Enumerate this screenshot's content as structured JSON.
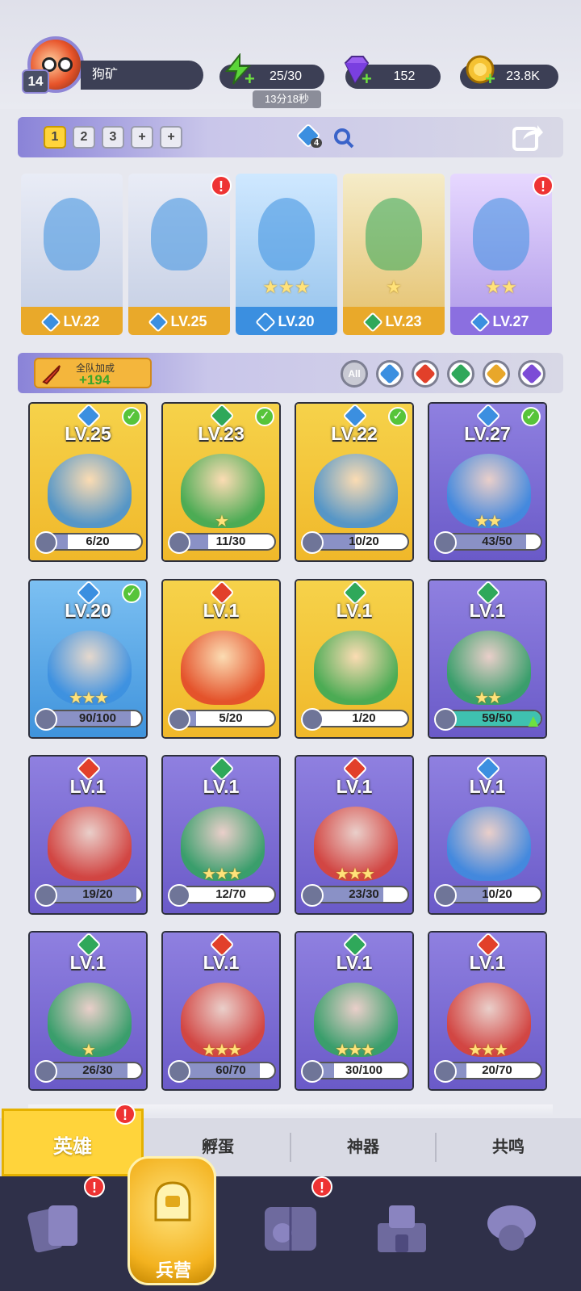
{
  "header": {
    "level": "14",
    "name": "狗矿",
    "energy": "25/30",
    "timer": "13分18秒",
    "gems": "152",
    "gold": "23.8K"
  },
  "team": {
    "slots": [
      "1",
      "2",
      "3",
      "+",
      "+"
    ],
    "count": "4"
  },
  "lineup": [
    {
      "lv": "LV.22",
      "elem": "water",
      "stars": ""
    },
    {
      "lv": "LV.25",
      "elem": "water",
      "stars": "",
      "alert": "!"
    },
    {
      "lv": "LV.20",
      "elem": "water",
      "stars": "★★★"
    },
    {
      "lv": "LV.23",
      "elem": "wind",
      "stars": "★"
    },
    {
      "lv": "LV.27",
      "elem": "water",
      "stars": "★★",
      "alert": "!"
    }
  ],
  "bonus": {
    "label": "全队加成",
    "value": "+194"
  },
  "filters": {
    "all": "All",
    "items": [
      "water",
      "fire",
      "wind",
      "light",
      "dark"
    ]
  },
  "heroes": [
    {
      "lv": "LV.25",
      "elem": "water",
      "progress": "6/20",
      "fill": 0.3,
      "stars": "",
      "check": true,
      "frame": "gold"
    },
    {
      "lv": "LV.23",
      "elem": "wind",
      "progress": "11/30",
      "fill": 0.37,
      "stars": "★",
      "check": true,
      "frame": "gold"
    },
    {
      "lv": "LV.22",
      "elem": "water",
      "progress": "10/20",
      "fill": 0.5,
      "stars": "",
      "check": true,
      "frame": "gold"
    },
    {
      "lv": "LV.27",
      "elem": "water",
      "progress": "43/50",
      "fill": 0.86,
      "stars": "★★",
      "check": true,
      "frame": "purple"
    },
    {
      "lv": "LV.20",
      "elem": "water",
      "progress": "90/100",
      "fill": 0.9,
      "stars": "★★★",
      "check": true,
      "frame": "blue"
    },
    {
      "lv": "LV.1",
      "elem": "fire",
      "progress": "5/20",
      "fill": 0.25,
      "stars": "",
      "check": false,
      "frame": "gold"
    },
    {
      "lv": "LV.1",
      "elem": "wind",
      "progress": "1/20",
      "fill": 0.05,
      "stars": "",
      "check": false,
      "frame": "gold"
    },
    {
      "lv": "LV.1",
      "elem": "wind",
      "progress": "59/50",
      "fill": 1.0,
      "stars": "★★",
      "check": false,
      "frame": "purple",
      "upgrade": true
    },
    {
      "lv": "LV.1",
      "elem": "fire",
      "progress": "19/20",
      "fill": 0.95,
      "stars": "",
      "check": false,
      "frame": "purple"
    },
    {
      "lv": "LV.1",
      "elem": "wind",
      "progress": "12/70",
      "fill": 0.17,
      "stars": "★★★",
      "check": false,
      "frame": "purple"
    },
    {
      "lv": "LV.1",
      "elem": "fire",
      "progress": "23/30",
      "fill": 0.77,
      "stars": "★★★",
      "check": false,
      "frame": "purple"
    },
    {
      "lv": "LV.1",
      "elem": "water",
      "progress": "10/20",
      "fill": 0.5,
      "stars": "",
      "check": false,
      "frame": "purple"
    },
    {
      "lv": "LV.1",
      "elem": "wind",
      "progress": "26/30",
      "fill": 0.87,
      "stars": "★",
      "check": false,
      "frame": "purple"
    },
    {
      "lv": "LV.1",
      "elem": "fire",
      "progress": "60/70",
      "fill": 0.86,
      "stars": "★★★",
      "check": false,
      "frame": "purple"
    },
    {
      "lv": "LV.1",
      "elem": "wind",
      "progress": "30/100",
      "fill": 0.3,
      "stars": "★★★",
      "check": false,
      "frame": "purple"
    },
    {
      "lv": "LV.1",
      "elem": "fire",
      "progress": "20/70",
      "fill": 0.29,
      "stars": "★★★",
      "check": false,
      "frame": "purple"
    }
  ],
  "tabs": [
    "英雄",
    "孵蛋",
    "神器",
    "共鸣"
  ],
  "nav": {
    "active_label": "兵营"
  },
  "colors": {
    "water": "#3b8fe0",
    "fire": "#e2402a",
    "wind": "#2fa85a",
    "light": "#e8a72a",
    "dark": "#7c4bd6",
    "gold": "#f3c235",
    "purple": "#7b6fd4",
    "blue": "#4aa3e6"
  }
}
